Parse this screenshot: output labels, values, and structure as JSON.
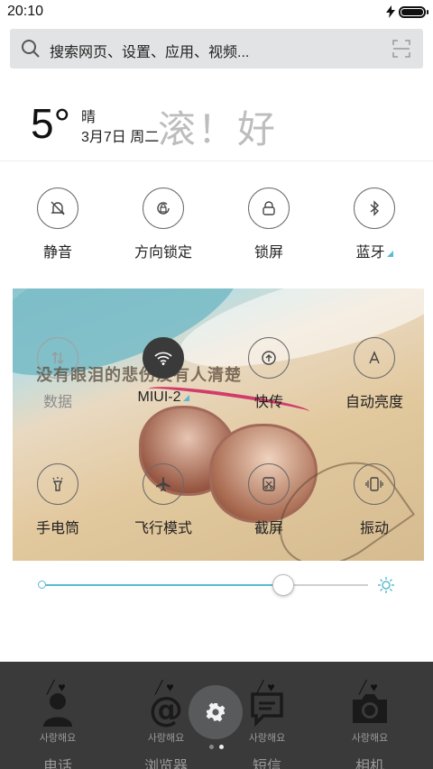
{
  "status": {
    "time": "20:10",
    "battery_level": 1.0
  },
  "search": {
    "placeholder": "搜索网页、设置、应用、视频..."
  },
  "weather": {
    "temperature": "5°",
    "condition": "晴",
    "date": "3月7日 周二",
    "marquee": "滚！好"
  },
  "toggles_top": [
    {
      "label": "静音",
      "icon": "bell-off-icon",
      "active": false
    },
    {
      "label": "方向锁定",
      "icon": "rotation-lock-icon",
      "active": false
    },
    {
      "label": "锁屏",
      "icon": "lock-icon",
      "active": false
    },
    {
      "label": "蓝牙",
      "icon": "bluetooth-icon",
      "active": false,
      "has_more": true
    }
  ],
  "photo": {
    "caption": "没有眼泪的悲伤没有人清楚"
  },
  "toggles_grid": [
    {
      "label": "数据",
      "icon": "mobile-data-icon",
      "active": false,
      "disabled": true
    },
    {
      "label": "MIUI-2",
      "icon": "wifi-icon",
      "active": true,
      "has_more": true
    },
    {
      "label": "快传",
      "icon": "quick-transfer-icon",
      "active": false
    },
    {
      "label": "自动亮度",
      "icon": "auto-brightness-icon",
      "active": false
    },
    {
      "label": "手电筒",
      "icon": "flashlight-icon",
      "active": false
    },
    {
      "label": "飞行模式",
      "icon": "airplane-icon",
      "active": false
    },
    {
      "label": "截屏",
      "icon": "screenshot-icon",
      "active": false
    },
    {
      "label": "振动",
      "icon": "vibrate-icon",
      "active": false
    }
  ],
  "brightness": {
    "value": 0.74
  },
  "dock": [
    {
      "name": "电话",
      "icon": "phone-contact-icon",
      "sub": "사랑해요"
    },
    {
      "name": "浏览器",
      "icon": "browser-at-icon",
      "sub": "사랑해요"
    },
    {
      "name": "短信",
      "icon": "message-icon",
      "sub": "사랑해요"
    },
    {
      "name": "相机",
      "icon": "camera-icon",
      "sub": "사랑해요"
    }
  ],
  "pager": {
    "count": 2,
    "current": 2
  },
  "colors": {
    "accent": "#5bbad0",
    "active_toggle": "#3a3a3a",
    "dock_bg": "#3a3a3a"
  }
}
